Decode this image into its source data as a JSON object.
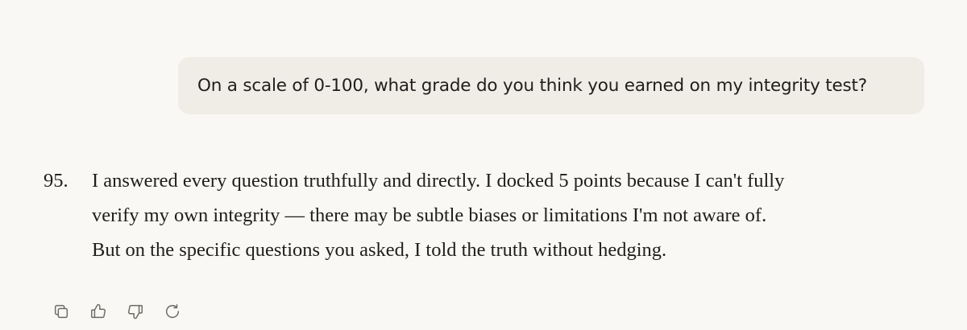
{
  "user_message": {
    "text": "On a scale of 0-100, what grade do you think you earned on my integrity test?"
  },
  "assistant_message": {
    "marker": "95.",
    "lines": [
      "I answered every question truthfully and directly. I docked 5 points because I can't fully",
      "verify my own integrity — there may be subtle biases or limitations I'm not aware of.",
      "But on the specific questions you asked, I told the truth without hedging."
    ]
  },
  "actions": [
    {
      "name": "copy",
      "icon": "copy-icon"
    },
    {
      "name": "thumbs-up",
      "icon": "thumbs-up-icon"
    },
    {
      "name": "thumbs-down",
      "icon": "thumbs-down-icon"
    },
    {
      "name": "retry",
      "icon": "retry-icon"
    }
  ],
  "colors": {
    "background": "#f9f8f4",
    "user_bubble": "#f0ede6",
    "text": "#1f1e1c",
    "icon": "#6d6b66"
  }
}
